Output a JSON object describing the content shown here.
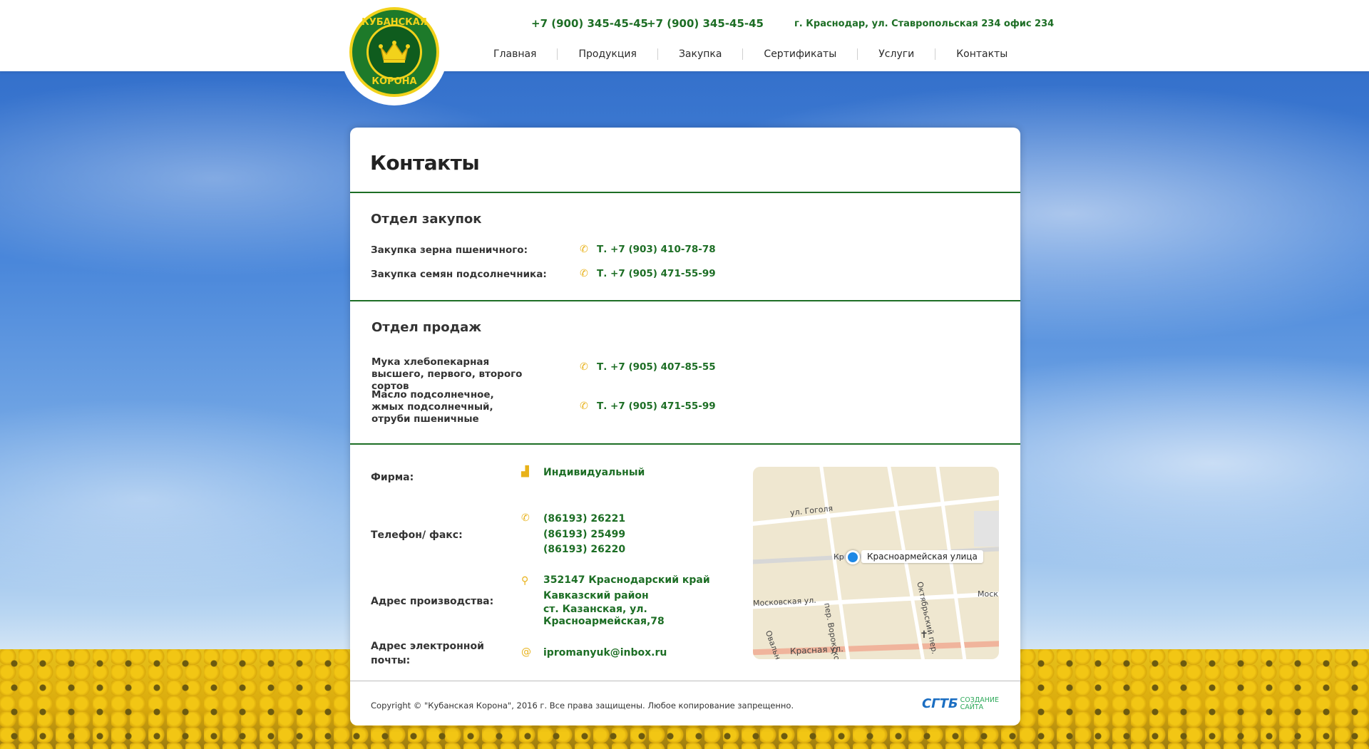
{
  "header": {
    "logo_top": "КУБАНСКАЯ",
    "logo_bottom": "КОРОНА",
    "phone_1": "+7 (900) 345-45-45",
    "phone_2": "+7 (900) 345-45-45",
    "address": "г. Краснодар, ул. Ставропольская 234 офис 234"
  },
  "nav": [
    "Главная",
    "Продукция",
    "Закупка",
    "Сертификаты",
    "Услуги",
    "Контакты"
  ],
  "page_title": "Контакты",
  "purchase": {
    "title": "Отдел закупок",
    "rows": [
      {
        "label": "Закупка зерна пшеничного:",
        "phone": "Т. +7 (903) 410-78-78"
      },
      {
        "label": "Закупка семян подсолнечника:",
        "phone": "Т. +7 (905) 471-55-99"
      }
    ]
  },
  "sales": {
    "title": "Отдел продаж",
    "rows": [
      {
        "label": "Мука хлебопекарная высшего, первого, второго сортов",
        "phone": "Т. +7 (905) 407-85-55"
      },
      {
        "label": "Масло подсолнечное, жмых подсолнечный, отруби пшеничные",
        "phone": "Т. +7 (905) 471-55-99"
      }
    ]
  },
  "info": {
    "firm_label": "Фирма:",
    "firm_value": "Индивидуальный",
    "phone_label": "Телефон/ факс:",
    "phones": [
      "(86193) 26221",
      "(86193) 25499",
      "(86193) 26220"
    ],
    "address_label": "Адрес производства:",
    "address_lines": [
      "352147 Краснодарский край",
      "Кавказский район",
      "ст. Казанская, ул.",
      "Красноармейская,78"
    ],
    "email_label": "Адрес электронной почты:",
    "email": "ipromanyuk@inbox.ru"
  },
  "map": {
    "pin_label": "Красноармейская улица",
    "streets": [
      "ул. Гоголя",
      "Московская ул.",
      "пер. Ворокского",
      "Октябрьский пер.",
      "Овальная",
      "Красная ул.",
      "Моск",
      "Кр"
    ]
  },
  "footer": {
    "copyright": "Copyright © \"Кубанская Корона\", 2016 г.  Все права защищены. Любое копирование запрещенно.",
    "dev_mark": "СГТБ",
    "dev_text_1": "СОЗДАНИЕ",
    "dev_text_2": "САЙТА"
  },
  "colors": {
    "accent_green": "#1d6e25",
    "icon_gold": "#e8b21a"
  },
  "icons": {
    "phone": "phone-icon",
    "firm": "briefcase-icon",
    "address": "pin-icon",
    "email": "at-icon"
  }
}
